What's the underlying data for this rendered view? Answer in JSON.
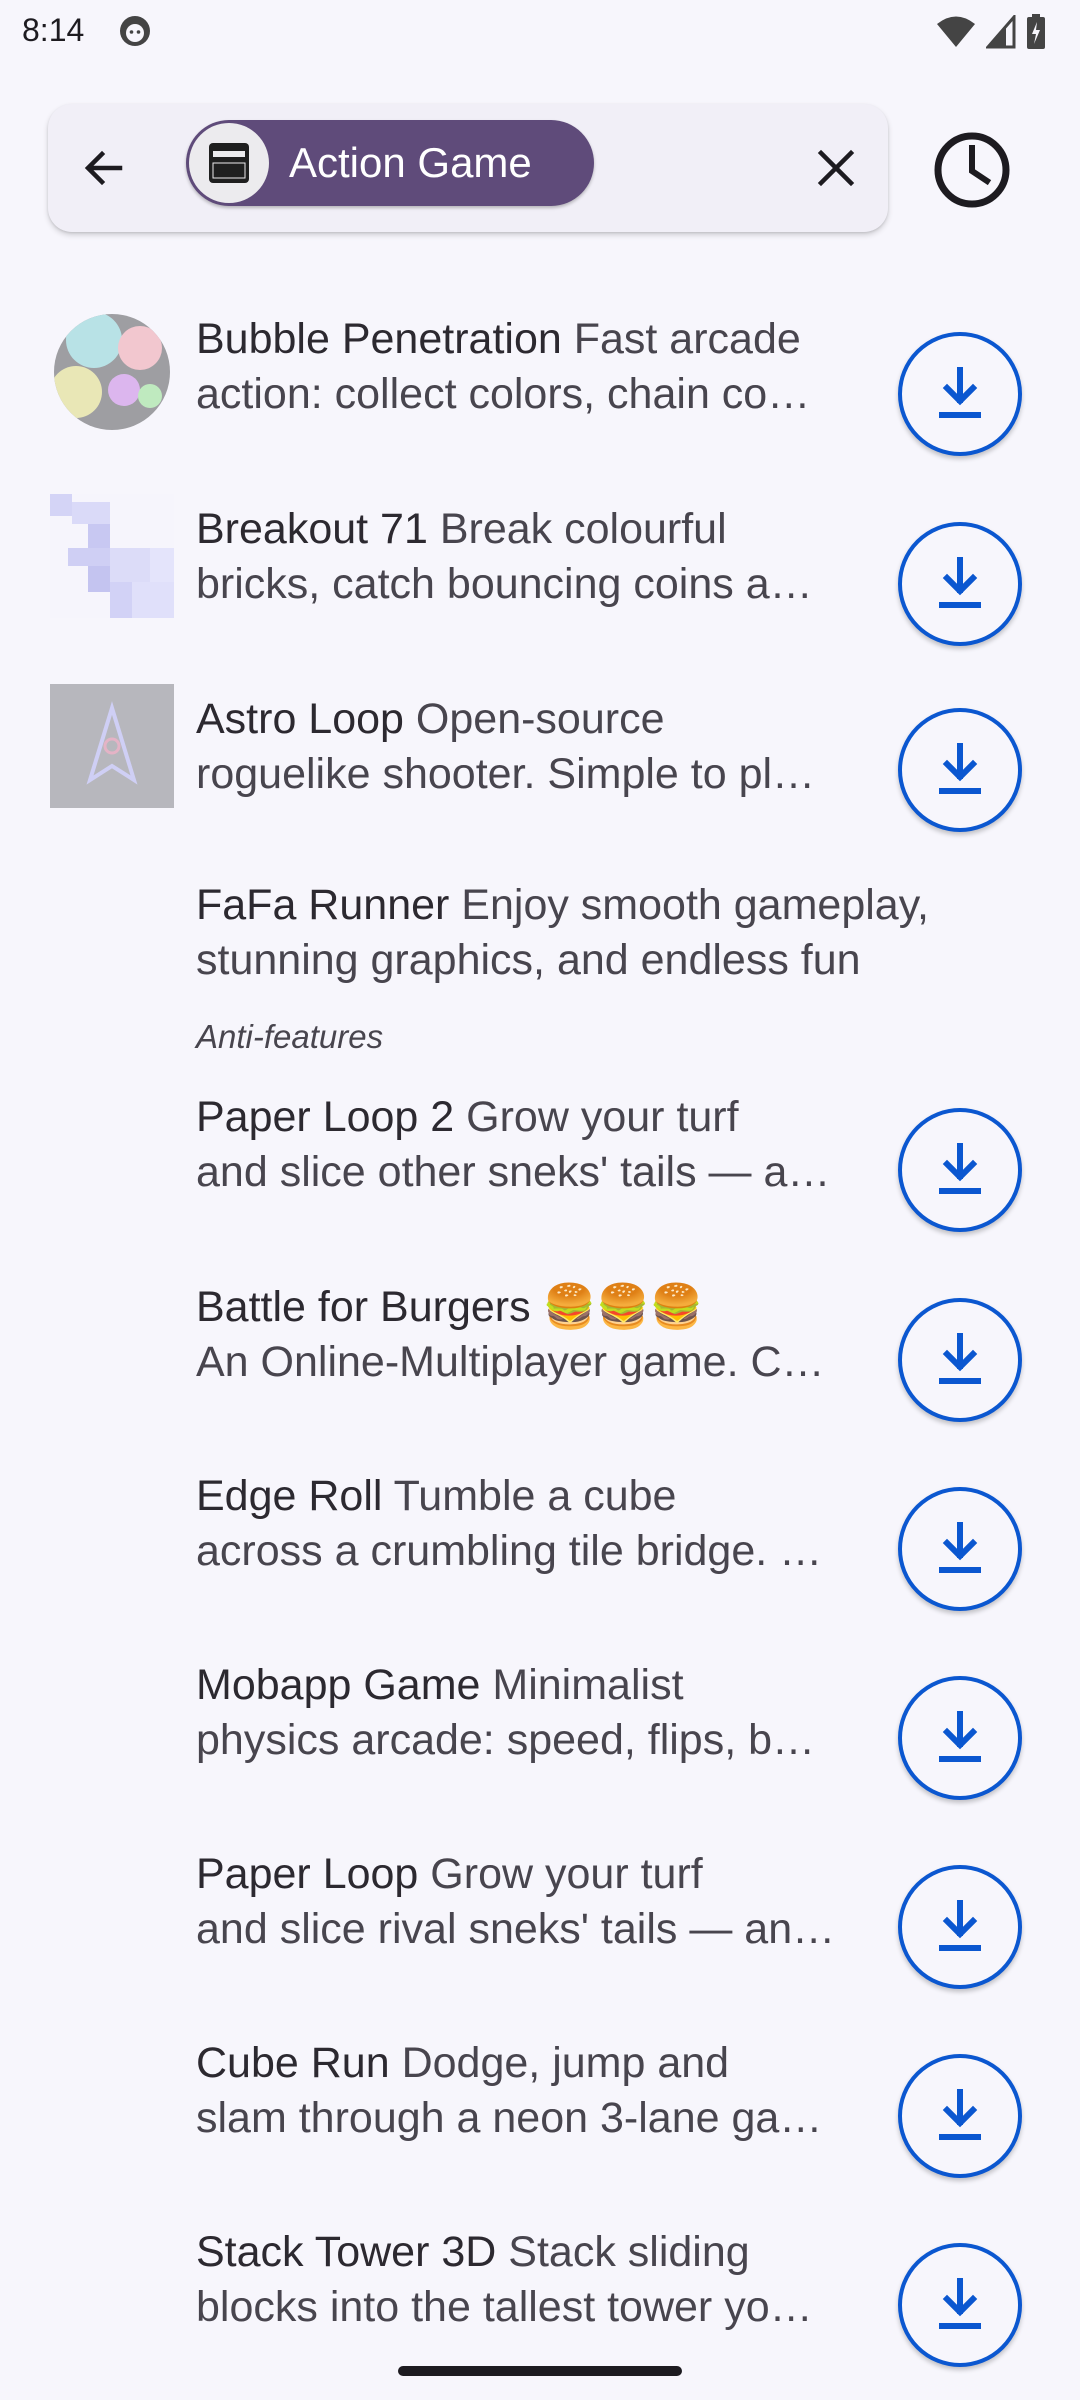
{
  "status_bar": {
    "time": "8:14"
  },
  "search": {
    "chip_label": "Action Game",
    "back_icon": "arrow-back-icon",
    "clear_icon": "close-icon",
    "history_icon": "history-clock-icon"
  },
  "anti_features_label": "Anti-features",
  "apps": [
    {
      "name": "Bubble Penetration",
      "line1": " Fast arcade",
      "line2": "action: collect colors, chain co…",
      "has_download": true
    },
    {
      "name": "Breakout 71",
      "line1": " Break colourful",
      "line2": "bricks, catch bouncing coins a…",
      "has_download": true
    },
    {
      "name": "Astro Loop",
      "line1": " Open-source",
      "line2": "roguelike shooter. Simple to pl…",
      "has_download": true
    },
    {
      "name": "FaFa Runner",
      "line1": " Enjoy smooth gameplay,",
      "line2": "stunning graphics, and endless fun",
      "has_download": false
    },
    {
      "name": "Paper Loop 2",
      "line1": " Grow your turf",
      "line2": "and slice other sneks' tails — a…",
      "has_download": true
    },
    {
      "name": "Battle for Burgers",
      "line1": " 🍔🍔🍔",
      "line2": "An Online-Multiplayer game. C…",
      "has_download": true
    },
    {
      "name": "Edge Roll",
      "line1": " Tumble a cube",
      "line2": "across a crumbling tile bridge. …",
      "has_download": true
    },
    {
      "name": "Mobapp Game",
      "line1": " Minimalist",
      "line2": "physics arcade: speed, flips, b…",
      "has_download": true
    },
    {
      "name": "Paper Loop",
      "line1": " Grow your turf",
      "line2": "and slice rival sneks' tails — an…",
      "has_download": true
    },
    {
      "name": "Cube Run",
      "line1": " Dodge, jump and",
      "line2": "slam through a neon 3-lane ga…",
      "has_download": true
    },
    {
      "name": "Stack Tower 3D",
      "line1": " Stack sliding",
      "line2": "blocks into the tallest tower yo…",
      "has_download": true
    }
  ],
  "colors": {
    "accent": "#0b57d0",
    "chip_bg": "#5f4b7a",
    "background": "#f7f6fc"
  }
}
